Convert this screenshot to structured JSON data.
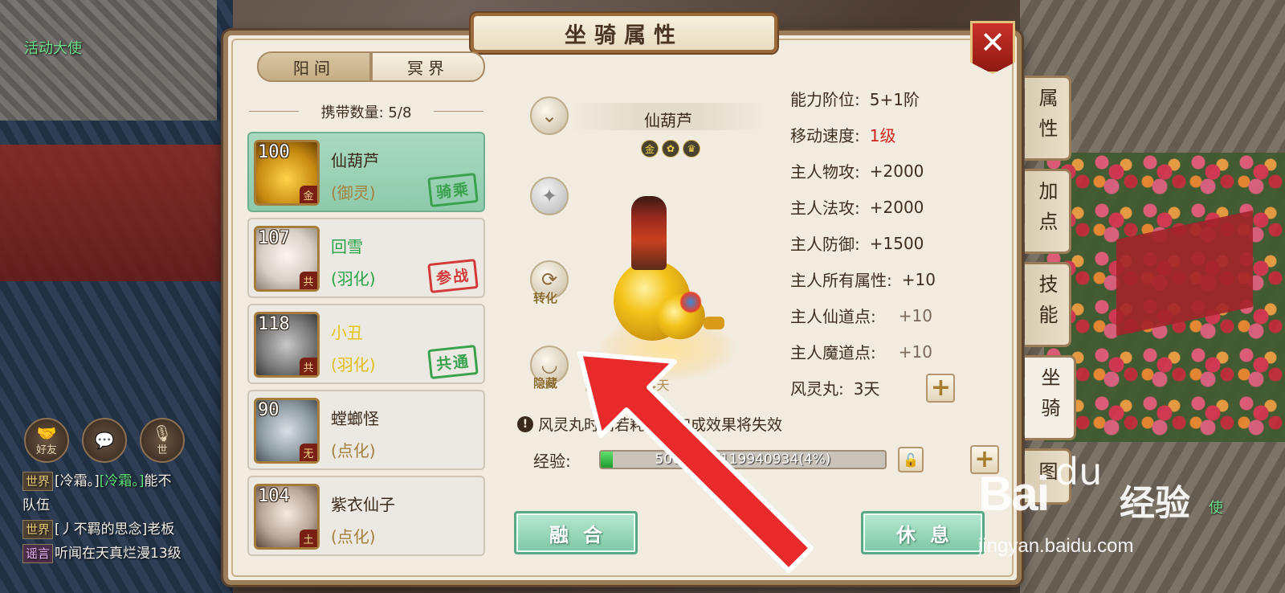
{
  "background": {
    "npc_left": "活动大使",
    "npc_right": "使",
    "chat_buttons": [
      {
        "label": "好友",
        "icon": "handshake-icon"
      },
      {
        "label": "",
        "icon": "chat-bubble-icon"
      },
      {
        "label": "世",
        "icon": "microphone-icon"
      }
    ],
    "chat_lines": [
      {
        "channel": "世界",
        "name": "[冷霜。]",
        "name2": "[冷霜。]",
        "text": "能不"
      },
      {
        "channel": "",
        "name": "",
        "name2": "",
        "text": "队伍"
      },
      {
        "channel": "世界",
        "name": "[丿不羁的思念]",
        "name2": "",
        "text": "老板"
      },
      {
        "channel": "谣言",
        "name": "",
        "name2": "",
        "text": "听闻在天真烂漫13级"
      }
    ]
  },
  "dialog": {
    "title": "坐骑属性",
    "close_label": "✕"
  },
  "left_panel": {
    "realm_tabs": [
      "阳间",
      "冥界"
    ],
    "capacity_label": "携带数量:",
    "capacity_value": "5/8",
    "mounts": [
      {
        "level": "100",
        "name": "仙葫芦",
        "type": "(御灵)",
        "stamp": "骑乘",
        "corner": "金"
      },
      {
        "level": "107",
        "name": "回雪",
        "type": "(羽化)",
        "stamp": "参战",
        "corner": "共"
      },
      {
        "level": "118",
        "name": "小丑",
        "type": "(羽化)",
        "stamp": "共通",
        "corner": "共"
      },
      {
        "level": "90",
        "name": "螳螂怪",
        "type": "(点化)",
        "stamp": "",
        "corner": "无"
      },
      {
        "level": "104",
        "name": "紫衣仙子",
        "type": "(点化)",
        "stamp": "",
        "corner": "土"
      }
    ]
  },
  "viewer": {
    "mount_name": "仙葫芦",
    "badges": [
      "金",
      "✿",
      "♛"
    ],
    "transform_label": "转化",
    "hide_label": "隐藏",
    "trade_text": "限制交易 14天"
  },
  "stats": [
    {
      "label": "能力阶位:",
      "value": "5+1阶"
    },
    {
      "label": "移动速度:",
      "value": "1级"
    },
    {
      "label": "主人物攻:",
      "value": "+2000"
    },
    {
      "label": "主人法攻:",
      "value": "+2000"
    },
    {
      "label": "主人防御:",
      "value": "+1500"
    },
    {
      "label": "主人所有属性:",
      "value": "+10"
    },
    {
      "label": "主人仙道点:",
      "value": "+10"
    },
    {
      "label": "主人魔道点:",
      "value": "+10"
    },
    {
      "label": "风灵丸:",
      "value": "3天"
    }
  ],
  "warning": "风灵丸时间若耗尽，加成效果将失效",
  "experience": {
    "label": "经验:",
    "text": "5068952/119940934(4%)",
    "fraction": 0.042
  },
  "buttons": {
    "merge": "融合",
    "rest": "休息"
  },
  "side_tabs": [
    "属性",
    "加点",
    "技能",
    "坐骑",
    "图"
  ],
  "watermark": {
    "logo": "Bai",
    "paw": "du",
    "brand": "经验",
    "url": "jingyan.baidu.com"
  },
  "colors": {
    "accent_red": "#d0231c",
    "selected_card": "#a9d9c0",
    "arrow": "#e82a2a"
  }
}
